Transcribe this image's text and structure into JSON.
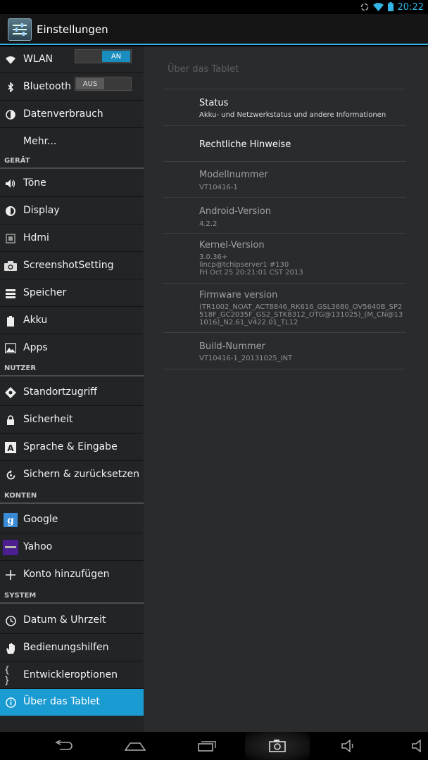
{
  "status_bar": {
    "time": "20:22"
  },
  "action_bar": {
    "title": "Einstellungen"
  },
  "sidebar": {
    "wlan": {
      "label": "WLAN",
      "toggle": "AN"
    },
    "bluetooth": {
      "label": "Bluetooth",
      "toggle": "AUS"
    },
    "datenverbrauch": "Datenverbrauch",
    "mehr": "Mehr...",
    "section_geraet": "GERÄT",
    "toene": "Töne",
    "display": "Display",
    "hdmi": "Hdmi",
    "screenshot": "ScreenshotSetting",
    "speicher": "Speicher",
    "akku": "Akku",
    "apps": "Apps",
    "section_nutzer": "NUTZER",
    "standort": "Standortzugriff",
    "sicherheit": "Sicherheit",
    "sprache": "Sprache & Eingabe",
    "sichern": "Sichern & zurücksetzen",
    "section_konten": "KONTEN",
    "google": "Google",
    "yahoo": "Yahoo",
    "konto": "Konto hinzufügen",
    "section_system": "SYSTEM",
    "datum": "Datum & Uhrzeit",
    "bedienung": "Bedienungshilfen",
    "entwickler": "Entwickleroptionen",
    "ueber": "Über das Tablet"
  },
  "detail": {
    "header": "Über das Tablet",
    "status": {
      "title": "Status",
      "summary": "Akku- und Netzwerkstatus und andere Informationen"
    },
    "legal": {
      "title": "Rechtliche Hinweise"
    },
    "model": {
      "title": "Modellnummer",
      "value": "VT10416-1"
    },
    "android": {
      "title": "Android-Version",
      "value": "4.2.2"
    },
    "kernel": {
      "title": "Kernel-Version",
      "value": "3.0.36+\nlincp@tchipserver1 #130\nFri Oct 25 20:21:01 CST 2013"
    },
    "firmware": {
      "title": "Firmware version",
      "value": "(TR1002_NOAT_ACT8846_RK616_GSL3680_OV5640B_SP2518F_GC2035F_GS2_STK8312_OTG@131025)_(M_CN@131016)_N2.61_V422.01_TL12"
    },
    "build": {
      "title": "Build-Nummer",
      "value": "VT10416-1_20131025_INT"
    }
  },
  "colors": {
    "accent": "#33b5e5",
    "selected": "#1a9bd1"
  },
  "icons": [
    "sync-icon",
    "wifi-icon",
    "battery-icon",
    "settings-icon",
    "back-icon",
    "home-icon",
    "recents-icon",
    "screenshot-icon",
    "volume-down-icon",
    "volume-up-icon"
  ]
}
